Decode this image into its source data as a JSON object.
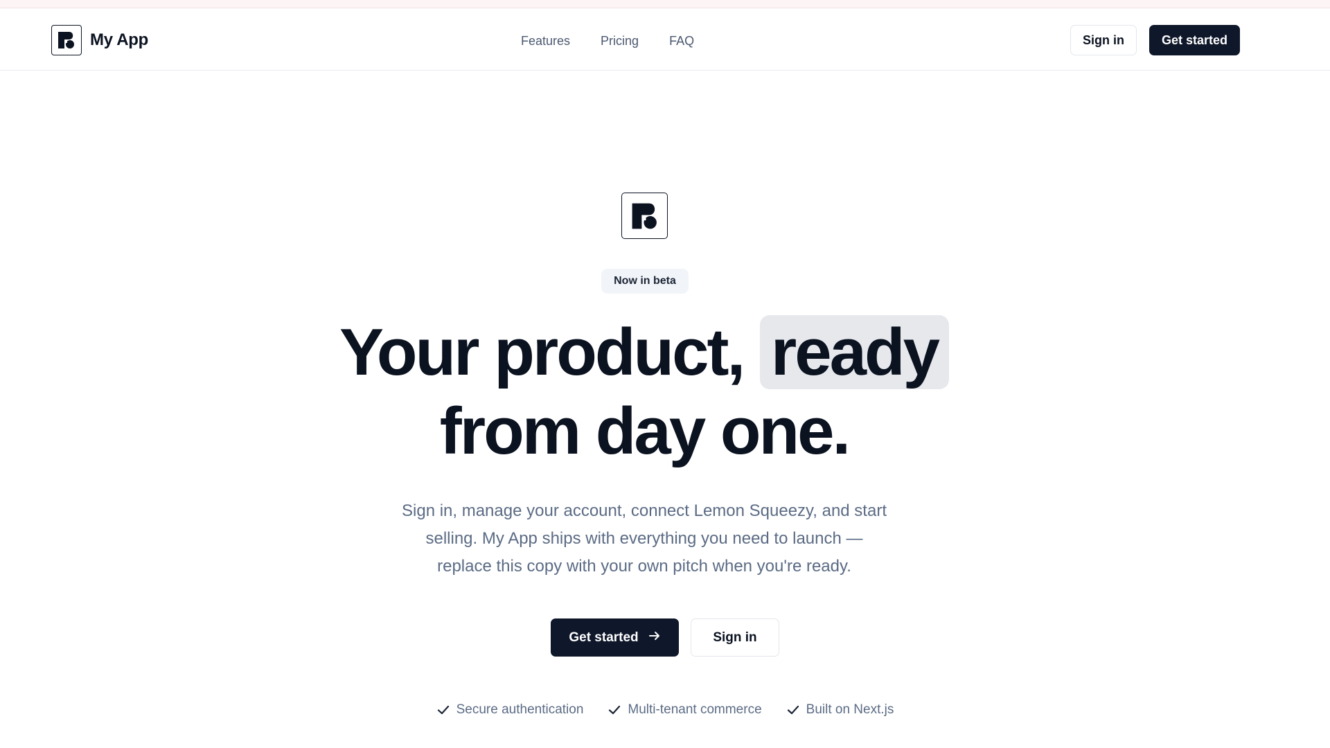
{
  "navbar": {
    "brand_name": "My App",
    "links": [
      {
        "label": "Features"
      },
      {
        "label": "Pricing"
      },
      {
        "label": "FAQ"
      }
    ],
    "sign_in_label": "Sign in",
    "get_started_label": "Get started"
  },
  "hero": {
    "badge": "Now in beta",
    "headline_part1": "Your product, ",
    "headline_highlight": "ready",
    "headline_line2": "from day one.",
    "subtitle": "Sign in, manage your account, connect Lemon Squeezy, and start selling. My App ships with everything you need to launch — replace this copy with your own pitch when you're ready.",
    "primary_cta": "Get started",
    "secondary_cta": "Sign in",
    "features": [
      {
        "label": "Secure authentication",
        "icon": "check-icon"
      },
      {
        "label": "Multi-tenant commerce",
        "icon": "check-icon"
      },
      {
        "label": "Built on Next.js",
        "icon": "check-icon"
      }
    ]
  },
  "colors": {
    "primary_dark": "#0f172a",
    "text_muted": "#5b6b84",
    "nav_link": "#4b5870",
    "highlight_bg": "#e6e8ec",
    "badge_bg": "#f1f4f8",
    "top_strip": "#fdf4f5"
  }
}
